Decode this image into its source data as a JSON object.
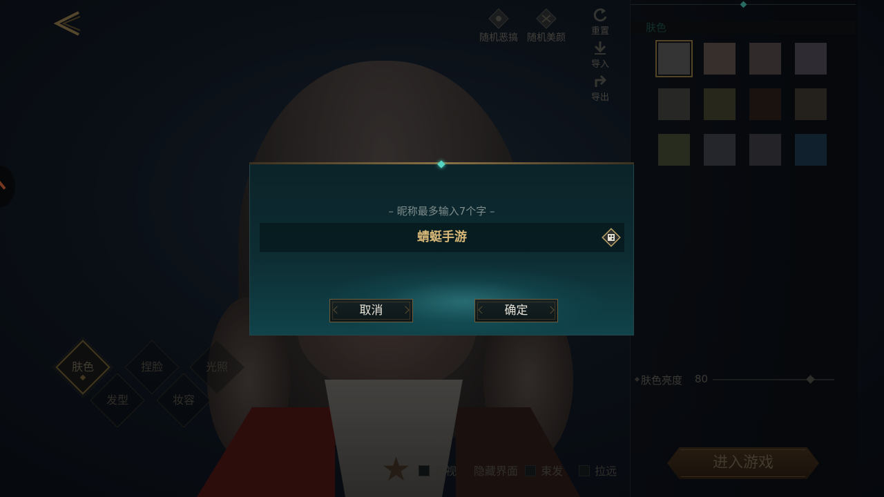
{
  "toolbar": {
    "random_funny": "随机恶搞",
    "random_beauty": "随机美颜",
    "reset": "重置",
    "import": "导入",
    "export": "导出"
  },
  "panel": {
    "section_title": "肤色",
    "swatches": [
      "#555555",
      "#5a4c48",
      "#4e4544",
      "#4d4651",
      "#3f403c",
      "#3f3f2c",
      "#2a1d17",
      "#3b342c",
      "#414731",
      "#3c3e46",
      "#3b3a41",
      "#1b344a"
    ],
    "selected_index": 0,
    "brightness_label": "肤色亮度",
    "brightness_value": "80",
    "brightness_level": 0.8,
    "enter_game": "进入游戏"
  },
  "categories": {
    "skin": "肤色",
    "face": "捏脸",
    "lighting": "光照",
    "hair": "发型",
    "makeup": "妆容"
  },
  "bottom_toggles": {
    "gaze": "注视",
    "hide_ui": "隐藏界面",
    "tie_hair": "束发",
    "zoom_out": "拉远"
  },
  "dialog": {
    "hint": "– 昵称最多输入7个字 –",
    "nickname": "蜻蜓手游",
    "cancel": "取消",
    "confirm": "确定"
  },
  "colors": {
    "accent_gold": "#d7b777",
    "accent_teal": "#56d6c2"
  }
}
